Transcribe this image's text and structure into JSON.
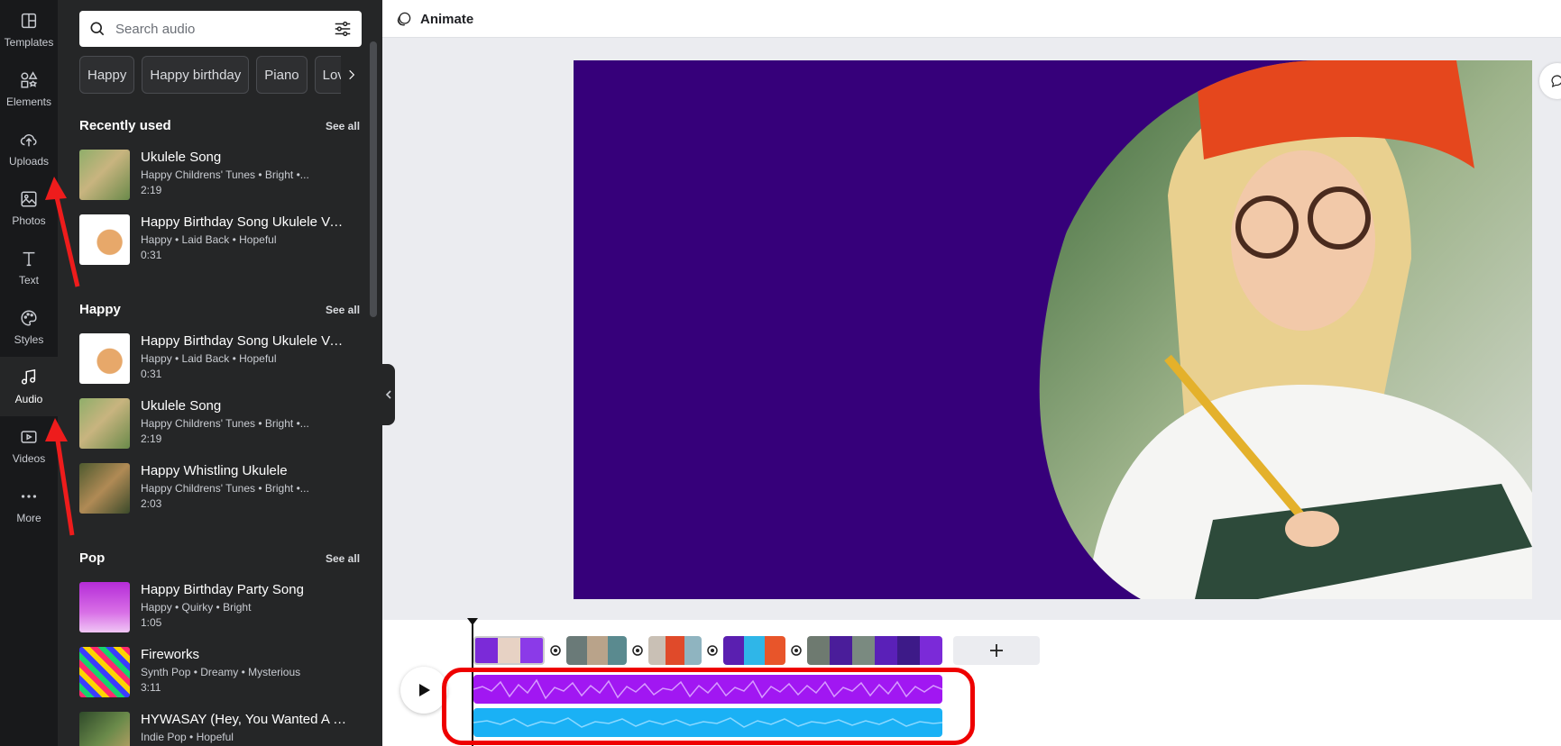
{
  "rail": [
    {
      "label": "Templates",
      "icon": "templates-icon"
    },
    {
      "label": "Elements",
      "icon": "elements-icon"
    },
    {
      "label": "Uploads",
      "icon": "upload-cloud-icon"
    },
    {
      "label": "Photos",
      "icon": "photo-icon"
    },
    {
      "label": "Text",
      "icon": "text-icon"
    },
    {
      "label": "Styles",
      "icon": "palette-icon"
    },
    {
      "label": "Audio",
      "icon": "music-note-icon",
      "active": true
    },
    {
      "label": "Videos",
      "icon": "video-icon"
    },
    {
      "label": "More",
      "icon": "more-dots-icon"
    }
  ],
  "search": {
    "placeholder": "Search audio"
  },
  "chips": [
    "Happy",
    "Happy birthday",
    "Piano",
    "Love"
  ],
  "see_all": "See all",
  "sections": {
    "recent": {
      "title": "Recently used",
      "tracks": [
        {
          "title": "Ukulele Song",
          "meta": "Happy Childrens' Tunes • Bright •...",
          "duration": "2:19"
        },
        {
          "title": "Happy Birthday Song Ukulele Ver...",
          "meta": "Happy • Laid Back • Hopeful",
          "duration": "0:31"
        }
      ]
    },
    "happy": {
      "title": "Happy",
      "tracks": [
        {
          "title": "Happy Birthday Song Ukulele Ver...",
          "meta": "Happy • Laid Back • Hopeful",
          "duration": "0:31"
        },
        {
          "title": "Ukulele Song",
          "meta": "Happy Childrens' Tunes • Bright •...",
          "duration": "2:19"
        },
        {
          "title": "Happy Whistling Ukulele",
          "meta": "Happy Childrens' Tunes • Bright •...",
          "duration": "2:03"
        }
      ]
    },
    "pop": {
      "title": "Pop",
      "tracks": [
        {
          "title": "Happy Birthday Party Song",
          "meta": "Happy • Quirky • Bright",
          "duration": "1:05"
        },
        {
          "title": "Fireworks",
          "meta": "Synth Pop • Dreamy • Mysterious",
          "duration": "3:11"
        },
        {
          "title": "HYWASAY (Hey, You Wanted A So...",
          "meta": "Indie Pop • Hopeful",
          "duration": ""
        }
      ]
    }
  },
  "toolbar": {
    "animate_label": "Animate"
  },
  "colors": {
    "canvas_bg": "#36007a",
    "audio_track_1": "#a117f2",
    "audio_track_2": "#1ab1f5",
    "highlight": "#ee0000",
    "annotation_arrow": "#ee1c1c"
  }
}
